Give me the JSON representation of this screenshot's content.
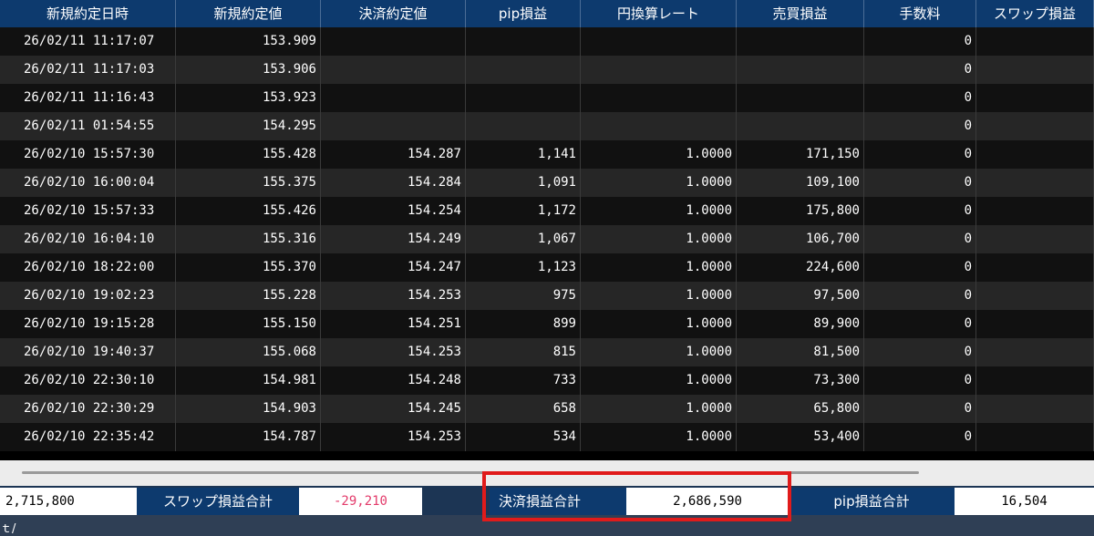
{
  "table": {
    "columns": [
      "新規約定日時",
      "新規約定値",
      "決済約定値",
      "pip損益",
      "円換算レート",
      "売買損益",
      "手数料",
      "スワップ損益"
    ],
    "rows": [
      [
        "26/02/11 11:17:07",
        "153.909",
        "",
        "",
        "",
        "",
        "0",
        ""
      ],
      [
        "26/02/11 11:17:03",
        "153.906",
        "",
        "",
        "",
        "",
        "0",
        ""
      ],
      [
        "26/02/11 11:16:43",
        "153.923",
        "",
        "",
        "",
        "",
        "0",
        ""
      ],
      [
        "26/02/11 01:54:55",
        "154.295",
        "",
        "",
        "",
        "",
        "0",
        ""
      ],
      [
        "26/02/10 15:57:30",
        "155.428",
        "154.287",
        "1,141",
        "1.0000",
        "171,150",
        "0",
        ""
      ],
      [
        "26/02/10 16:00:04",
        "155.375",
        "154.284",
        "1,091",
        "1.0000",
        "109,100",
        "0",
        ""
      ],
      [
        "26/02/10 15:57:33",
        "155.426",
        "154.254",
        "1,172",
        "1.0000",
        "175,800",
        "0",
        ""
      ],
      [
        "26/02/10 16:04:10",
        "155.316",
        "154.249",
        "1,067",
        "1.0000",
        "106,700",
        "0",
        ""
      ],
      [
        "26/02/10 18:22:00",
        "155.370",
        "154.247",
        "1,123",
        "1.0000",
        "224,600",
        "0",
        ""
      ],
      [
        "26/02/10 19:02:23",
        "155.228",
        "154.253",
        "975",
        "1.0000",
        "97,500",
        "0",
        ""
      ],
      [
        "26/02/10 19:15:28",
        "155.150",
        "154.251",
        "899",
        "1.0000",
        "89,900",
        "0",
        ""
      ],
      [
        "26/02/10 19:40:37",
        "155.068",
        "154.253",
        "815",
        "1.0000",
        "81,500",
        "0",
        ""
      ],
      [
        "26/02/10 22:30:10",
        "154.981",
        "154.248",
        "733",
        "1.0000",
        "73,300",
        "0",
        ""
      ],
      [
        "26/02/10 22:30:29",
        "154.903",
        "154.245",
        "658",
        "1.0000",
        "65,800",
        "0",
        ""
      ],
      [
        "26/02/10 22:35:42",
        "154.787",
        "154.253",
        "534",
        "1.0000",
        "53,400",
        "0",
        ""
      ]
    ]
  },
  "footer": {
    "trade_total_value": "2,715,800",
    "swap_total_label": "スワップ損益合計",
    "swap_total_value": "-29,210",
    "settlement_total_label": "決済損益合計",
    "settlement_total_value": "2,686,590",
    "pip_total_label": "pip損益合計",
    "pip_total_value": "16,504"
  },
  "bottom_text": "ｔ/",
  "colors": {
    "header_bg": "#0d3a6e",
    "negative": "#e33a6a",
    "highlight": "#e01b1b"
  }
}
